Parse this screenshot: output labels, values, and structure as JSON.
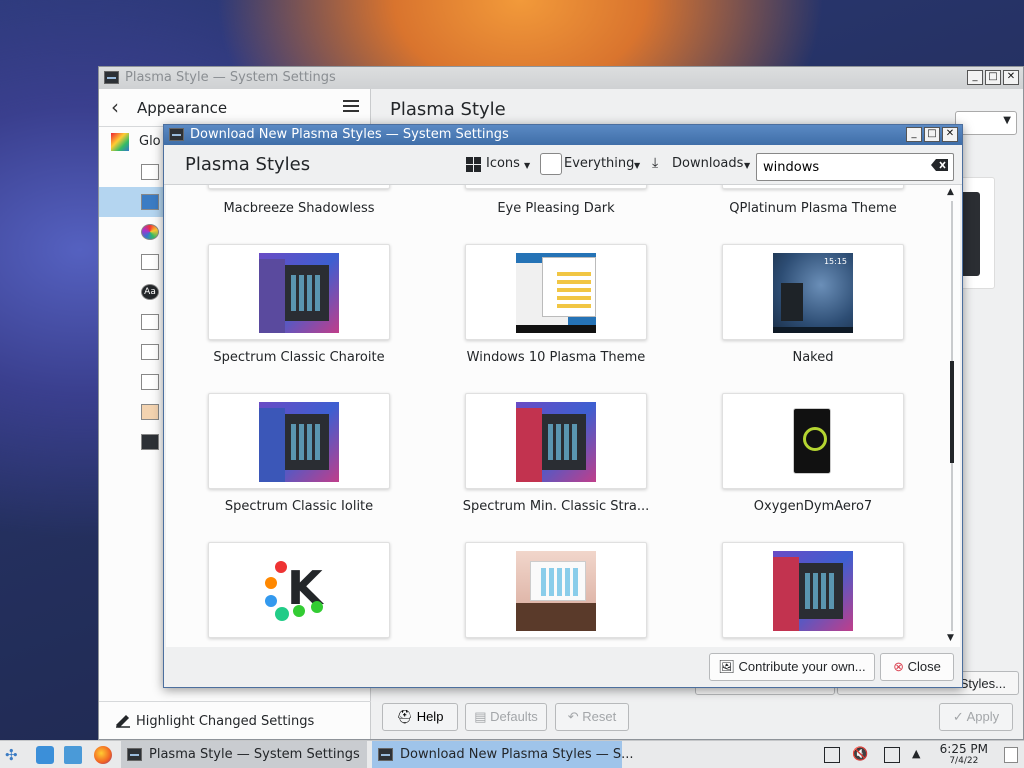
{
  "background_window": {
    "title": "Plasma Style — System Settings",
    "sidebar": {
      "back_label": "Appearance",
      "first_item": "Glo",
      "footer_label": "Highlight Changed Settings"
    },
    "main_title": "Plasma Style",
    "get_new_label": "Styles...",
    "buttons": {
      "help": "Help",
      "defaults": "Defaults",
      "reset": "Reset",
      "apply": "Apply"
    }
  },
  "dialog": {
    "title": "Download New Plasma Styles — System Settings",
    "heading": "Plasma Styles",
    "toolbar": {
      "view_label": "Icons",
      "filter_label": "Everything",
      "sort_label": "Downloads",
      "search_value": "windows"
    },
    "partial_row": [
      "Macbreeze Shadowless",
      "Eye Pleasing Dark",
      "QPlatinum Plasma Theme"
    ],
    "items": [
      {
        "label": "Spectrum Classic Charoite",
        "thumb": "violet"
      },
      {
        "label": "Windows 10 Plasma Theme",
        "thumb": "windows"
      },
      {
        "label": "Naked",
        "thumb": "naked",
        "time": "15:15"
      },
      {
        "label": "Spectrum Classic Iolite",
        "thumb": "violet"
      },
      {
        "label": "Spectrum Min. Classic Stra...",
        "thumb": "red"
      },
      {
        "label": "OxygenDymAero7",
        "thumb": "oxygen"
      },
      {
        "label": "",
        "thumb": "k-logo"
      },
      {
        "label": "",
        "thumb": "bright"
      },
      {
        "label": "",
        "thumb": "red"
      }
    ],
    "footer": {
      "contribute": "Contribute your own...",
      "close": "Close"
    }
  },
  "taskbar": {
    "tasks": [
      "Plasma Style  — System Settings",
      "Download New Plasma Styles — S..."
    ],
    "clock_time": "6:25 PM",
    "clock_date": "7/4/22"
  },
  "colors": {
    "dialog_titlebar": "#3f6ea8",
    "active_task": "#9fc4ea",
    "close_icon": "#da4453"
  }
}
